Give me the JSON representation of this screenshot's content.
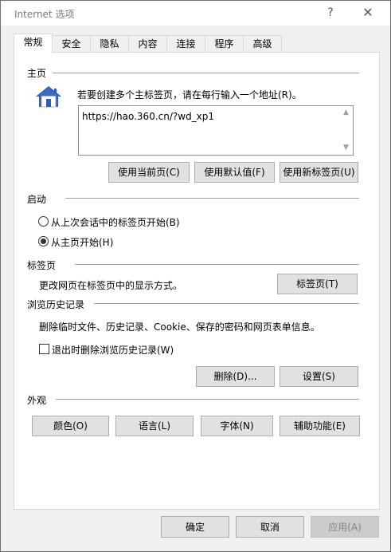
{
  "window": {
    "title": "Internet 选项",
    "help_glyph": "?",
    "close_glyph": "✕"
  },
  "tabs": [
    {
      "label": "常规",
      "active": true
    },
    {
      "label": "安全",
      "active": false
    },
    {
      "label": "隐私",
      "active": false
    },
    {
      "label": "内容",
      "active": false
    },
    {
      "label": "连接",
      "active": false
    },
    {
      "label": "程序",
      "active": false
    },
    {
      "label": "高级",
      "active": false
    }
  ],
  "homepage": {
    "section_title": "主页",
    "icon": "home-icon",
    "instruction": "若要创建多个主标签页，请在每行输入一个地址(R)。",
    "url_value": "https://hao.360.cn/?wd_xp1",
    "buttons": {
      "use_current": "使用当前页(C)",
      "use_default": "使用默认值(F)",
      "use_new_tab": "使用新标签页(U)"
    }
  },
  "startup": {
    "section_title": "启动",
    "options": [
      {
        "label": "从上次会话中的标签页开始(B)",
        "checked": false
      },
      {
        "label": "从主页开始(H)",
        "checked": true
      }
    ]
  },
  "tabs_section": {
    "section_title": "标签页",
    "description": "更改网页在标签页中的显示方式。",
    "button": "标签页(T)"
  },
  "history": {
    "section_title": "浏览历史记录",
    "description": "删除临时文件、历史记录、Cookie、保存的密码和网页表单信息。",
    "checkbox_label": "退出时删除浏览历史记录(W)",
    "checkbox_checked": false,
    "delete_button": "删除(D)...",
    "settings_button": "设置(S)"
  },
  "appearance": {
    "section_title": "外观",
    "buttons": {
      "colors": "颜色(O)",
      "languages": "语言(L)",
      "fonts": "字体(N)",
      "accessibility": "辅助功能(E)"
    }
  },
  "footer": {
    "ok": "确定",
    "cancel": "取消",
    "apply": "应用(A)",
    "apply_disabled": true
  },
  "colors": {
    "window_bg": "#f0f0f0",
    "panel_bg": "#ffffff",
    "button_bg": "#e1e1e1",
    "button_border": "#adadad",
    "house_roof": "#2f5fb5",
    "house_wall": "#ffffff"
  }
}
